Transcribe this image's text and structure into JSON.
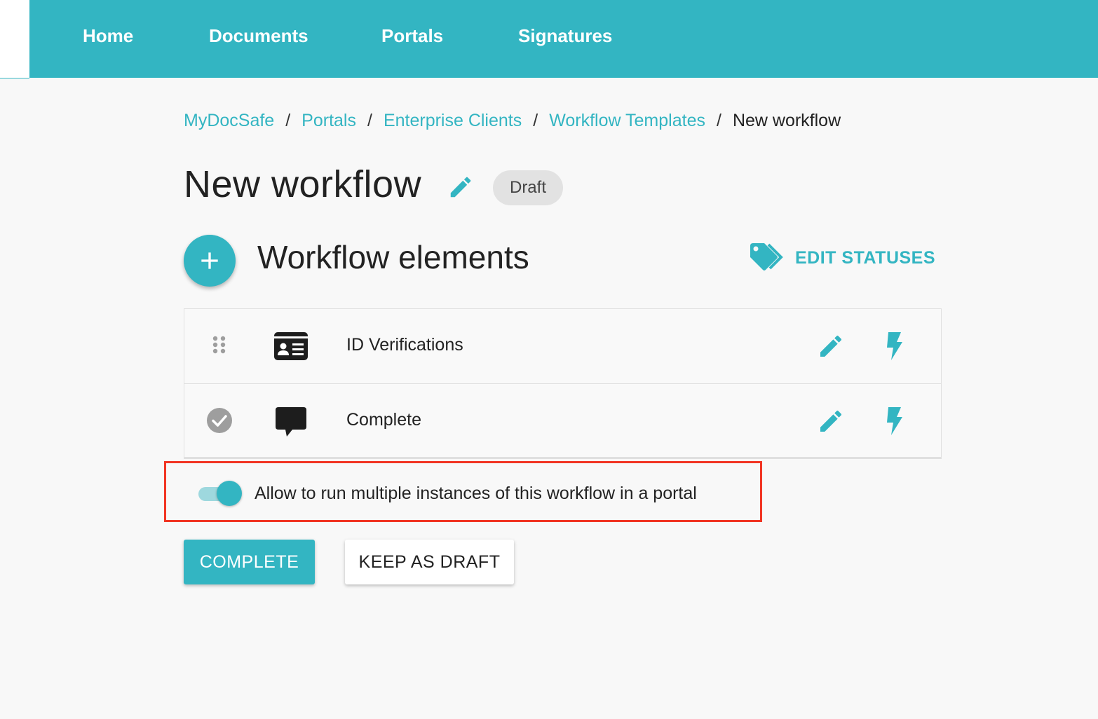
{
  "nav": {
    "items": [
      {
        "label": "Home"
      },
      {
        "label": "Documents"
      },
      {
        "label": "Portals"
      },
      {
        "label": "Signatures"
      }
    ]
  },
  "breadcrumb": {
    "items": [
      {
        "label": "MyDocSafe"
      },
      {
        "label": "Portals"
      },
      {
        "label": "Enterprise Clients"
      },
      {
        "label": "Workflow Templates"
      }
    ],
    "separator": "/",
    "current": "New workflow"
  },
  "page": {
    "title": "New workflow",
    "status_badge": "Draft"
  },
  "section": {
    "title": "Workflow elements",
    "edit_statuses_label": "EDIT STATUSES"
  },
  "elements": [
    {
      "label": "ID Verifications",
      "icon": "id-card-icon",
      "leading": "drag-handle-icon"
    },
    {
      "label": "Complete",
      "icon": "speech-bubble-icon",
      "leading": "check-circle-icon"
    }
  ],
  "option": {
    "label": "Allow to run multiple instances of this workflow in a portal",
    "enabled": true
  },
  "actions": {
    "complete_label": "COMPLETE",
    "draft_label": "KEEP AS DRAFT"
  },
  "colors": {
    "accent": "#33b5c2",
    "highlight": "#f13523",
    "badge_bg": "#e2e2e2"
  }
}
